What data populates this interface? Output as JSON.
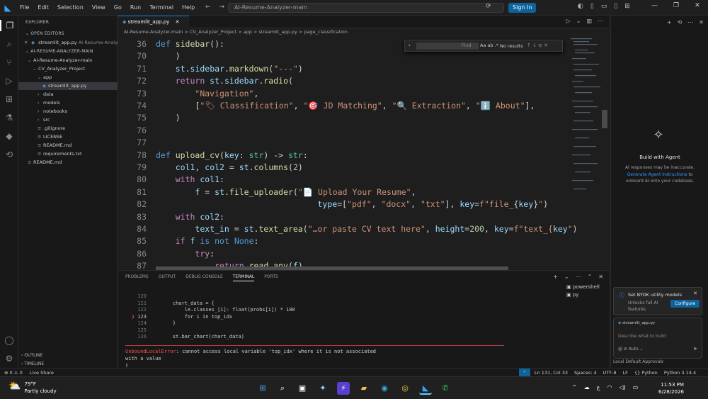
{
  "titlebar": {
    "menu": [
      "File",
      "Edit",
      "Selection",
      "View",
      "Go",
      "Run",
      "Terminal",
      "Help"
    ],
    "command_center": "AI-Resume-Analyzer-main",
    "sign_in": "Sign In"
  },
  "explorer": {
    "header": "EXPLORER",
    "open_editors_label": "OPEN EDITORS",
    "open_editor_file": "streamlit_app.py",
    "open_editor_path": "AI-Resume-Analyz...",
    "root_label": "AI-RESUME-ANALYZER-MAIN",
    "tree": [
      {
        "label": "AI-Resume-Analyzer-main",
        "indent": 1,
        "type": "folder-open"
      },
      {
        "label": "CV_Analyzer_Project",
        "indent": 2,
        "type": "folder-open"
      },
      {
        "label": "app",
        "indent": 3,
        "type": "folder-open"
      },
      {
        "label": "streamlit_app.py",
        "indent": 4,
        "type": "py",
        "selected": true
      },
      {
        "label": "data",
        "indent": 3,
        "type": "folder"
      },
      {
        "label": "models",
        "indent": 3,
        "type": "folder"
      },
      {
        "label": "notebooks",
        "indent": 3,
        "type": "folder"
      },
      {
        "label": "src",
        "indent": 3,
        "type": "folder"
      },
      {
        "label": ".gitignore",
        "indent": 3,
        "type": "file"
      },
      {
        "label": "LICENSE",
        "indent": 3,
        "type": "file"
      },
      {
        "label": "README.md",
        "indent": 3,
        "type": "file"
      },
      {
        "label": "requirements.txt",
        "indent": 3,
        "type": "file"
      },
      {
        "label": "README.md",
        "indent": 1,
        "type": "file"
      }
    ],
    "outline_label": "OUTLINE",
    "timeline_label": "TIMELINE"
  },
  "editor": {
    "tab_label": "streamlit_app.py",
    "breadcrumb": "AI-Resume-Analyzer-main > CV_Analyzer_Project > app > streamlit_app.py > page_classification",
    "find": {
      "placeholder": "Find",
      "options": "Aa ab .*",
      "result": "No results"
    },
    "lines": [
      {
        "n": "36",
        "tokens": [
          [
            "kw",
            "def "
          ],
          [
            "fn",
            "sidebar"
          ],
          [
            "plain",
            "():"
          ]
        ]
      },
      {
        "n": "70",
        "tokens": [
          [
            "plain",
            "    )"
          ]
        ]
      },
      {
        "n": "71",
        "tokens": [
          [
            "plain",
            "    "
          ],
          [
            "var",
            "st"
          ],
          [
            "plain",
            "."
          ],
          [
            "var",
            "sidebar"
          ],
          [
            "plain",
            "."
          ],
          [
            "fn",
            "markdown"
          ],
          [
            "plain",
            "("
          ],
          [
            "str",
            "\"---\""
          ],
          [
            "plain",
            ")"
          ]
        ]
      },
      {
        "n": "72",
        "tokens": [
          [
            "plain",
            "    "
          ],
          [
            "ctl",
            "return "
          ],
          [
            "var",
            "st"
          ],
          [
            "plain",
            "."
          ],
          [
            "var",
            "sidebar"
          ],
          [
            "plain",
            "."
          ],
          [
            "fn",
            "radio"
          ],
          [
            "plain",
            "("
          ]
        ]
      },
      {
        "n": "73",
        "tokens": [
          [
            "plain",
            "        "
          ],
          [
            "str",
            "\"Navigation\""
          ],
          [
            "plain",
            ","
          ]
        ]
      },
      {
        "n": "74",
        "tokens": [
          [
            "plain",
            "        ["
          ],
          [
            "str",
            "\"🏷 Classification\""
          ],
          [
            "plain",
            ", "
          ],
          [
            "str",
            "\"🎯 JD Matching\""
          ],
          [
            "plain",
            ", "
          ],
          [
            "str",
            "\"🔍 Extraction\""
          ],
          [
            "plain",
            ", "
          ],
          [
            "str",
            "\"ℹ️ About\""
          ],
          [
            "plain",
            "],"
          ]
        ]
      },
      {
        "n": "75",
        "tokens": [
          [
            "plain",
            "    )"
          ]
        ]
      },
      {
        "n": "76",
        "tokens": []
      },
      {
        "n": "77",
        "tokens": []
      },
      {
        "n": "78",
        "tokens": [
          [
            "kw",
            "def "
          ],
          [
            "fn",
            "upload_cv"
          ],
          [
            "plain",
            "("
          ],
          [
            "var",
            "key"
          ],
          [
            "plain",
            ": "
          ],
          [
            "ty",
            "str"
          ],
          [
            "plain",
            ") -> "
          ],
          [
            "ty",
            "str"
          ],
          [
            "plain",
            ":"
          ]
        ]
      },
      {
        "n": "79",
        "tokens": [
          [
            "plain",
            "    "
          ],
          [
            "var",
            "col1"
          ],
          [
            "plain",
            ", "
          ],
          [
            "var",
            "col2"
          ],
          [
            "plain",
            " = "
          ],
          [
            "var",
            "st"
          ],
          [
            "plain",
            "."
          ],
          [
            "fn",
            "columns"
          ],
          [
            "plain",
            "("
          ],
          [
            "num",
            "2"
          ],
          [
            "plain",
            ")"
          ]
        ]
      },
      {
        "n": "80",
        "tokens": [
          [
            "plain",
            "    "
          ],
          [
            "ctl",
            "with "
          ],
          [
            "var",
            "col1"
          ],
          [
            "plain",
            ":"
          ]
        ]
      },
      {
        "n": "81",
        "tokens": [
          [
            "plain",
            "        "
          ],
          [
            "var",
            "f"
          ],
          [
            "plain",
            " = "
          ],
          [
            "var",
            "st"
          ],
          [
            "plain",
            "."
          ],
          [
            "fn",
            "file_uploader"
          ],
          [
            "plain",
            "("
          ],
          [
            "str",
            "\"📄 Upload Your Resume\""
          ],
          [
            "plain",
            ","
          ]
        ]
      },
      {
        "n": "82",
        "tokens": [
          [
            "plain",
            "                                 "
          ],
          [
            "var",
            "type"
          ],
          [
            "plain",
            "=["
          ],
          [
            "str",
            "\"pdf\""
          ],
          [
            "plain",
            ", "
          ],
          [
            "str",
            "\"docx\""
          ],
          [
            "plain",
            ", "
          ],
          [
            "str",
            "\"txt\""
          ],
          [
            "plain",
            "], "
          ],
          [
            "var",
            "key"
          ],
          [
            "plain",
            "="
          ],
          [
            "str",
            "f\"file_"
          ],
          [
            "plain",
            "{"
          ],
          [
            "var",
            "key"
          ],
          [
            "plain",
            "}"
          ],
          [
            "str",
            "\""
          ],
          [
            "plain",
            ")"
          ]
        ]
      },
      {
        "n": "83",
        "tokens": [
          [
            "plain",
            "    "
          ],
          [
            "ctl",
            "with "
          ],
          [
            "var",
            "col2"
          ],
          [
            "plain",
            ":"
          ]
        ]
      },
      {
        "n": "84",
        "tokens": [
          [
            "plain",
            "        "
          ],
          [
            "var",
            "text_in"
          ],
          [
            "plain",
            " = "
          ],
          [
            "var",
            "st"
          ],
          [
            "plain",
            "."
          ],
          [
            "fn",
            "text_area"
          ],
          [
            "plain",
            "("
          ],
          [
            "str",
            "\"…or paste CV text here\""
          ],
          [
            "plain",
            ", "
          ],
          [
            "var",
            "height"
          ],
          [
            "plain",
            "="
          ],
          [
            "num",
            "200"
          ],
          [
            "plain",
            ", "
          ],
          [
            "var",
            "key"
          ],
          [
            "plain",
            "="
          ],
          [
            "str",
            "f\"text_{"
          ],
          [
            "var",
            "key"
          ],
          [
            "str",
            "\""
          ],
          [
            "plain",
            ")"
          ]
        ]
      },
      {
        "n": "85",
        "tokens": [
          [
            "plain",
            "    "
          ],
          [
            "ctl",
            "if "
          ],
          [
            "var",
            "f"
          ],
          [
            "plain",
            " "
          ],
          [
            "kw",
            "is not "
          ],
          [
            "kw",
            "None"
          ],
          [
            "plain",
            ":"
          ]
        ]
      },
      {
        "n": "86",
        "tokens": [
          [
            "plain",
            "        "
          ],
          [
            "ctl",
            "try"
          ],
          [
            "plain",
            ":"
          ]
        ]
      },
      {
        "n": "87",
        "tokens": [
          [
            "plain",
            "            "
          ],
          [
            "ctl",
            "return "
          ],
          [
            "fn",
            "read_any"
          ],
          [
            "plain",
            "("
          ],
          [
            "var",
            "f"
          ],
          [
            "plain",
            ")"
          ]
        ]
      }
    ]
  },
  "panel": {
    "tabs": [
      "PROBLEMS",
      "OUTPUT",
      "DEBUG CONSOLE",
      "TERMINAL",
      "PORTS"
    ],
    "active_tab": "TERMINAL",
    "terminal_lines": [
      {
        "n": "120",
        "text": ""
      },
      {
        "n": "121",
        "text": "    chart_data = {"
      },
      {
        "n": "122",
        "text": "        le.classes_[i]: float(probs[i]) * 100"
      },
      {
        "n": "123",
        "text": "        for i in top_idx"
      },
      {
        "n": "124",
        "text": "    }"
      },
      {
        "n": "125",
        "text": ""
      },
      {
        "n": "126",
        "text": "    st.bar_chart(chart_data)"
      }
    ],
    "current_marker": "❯",
    "error_name": "UnboundLocalError",
    "error_message": ": cannot access local variable 'top_idx' where it is not associated",
    "error_cont": "with a value",
    "terminal_list": [
      "powershell",
      "py"
    ]
  },
  "chat": {
    "title": "Build with Agent",
    "desc_pre": "AI responses may be inaccurate. ",
    "desc_link": "Generate Agent Instructions",
    "desc_post": " to onboard AI onto your codebase.",
    "byok_title": "Set BYOK utility models",
    "byok_desc": "Unlocks full AI features.",
    "byok_button": "Configure",
    "input_file": "streamlit_app.py",
    "input_placeholder": "Describe what to build",
    "input_tools": "@   ⊘   Auto   ⌄",
    "footer": "Local      Default Approvals"
  },
  "statusbar": {
    "left": [
      "⊗ 0 ⚠ 0",
      "Live Share"
    ],
    "right": [
      "Ln 131, Col 33",
      "Spaces: 4",
      "UTF-8",
      "LF",
      "{} Python",
      "Python 3.14.4"
    ]
  },
  "taskbar": {
    "temperature": "79°F",
    "weather": "Partly cloudy",
    "time": "11:53 PM",
    "date": "6/28/2026",
    "lang": "ع"
  }
}
